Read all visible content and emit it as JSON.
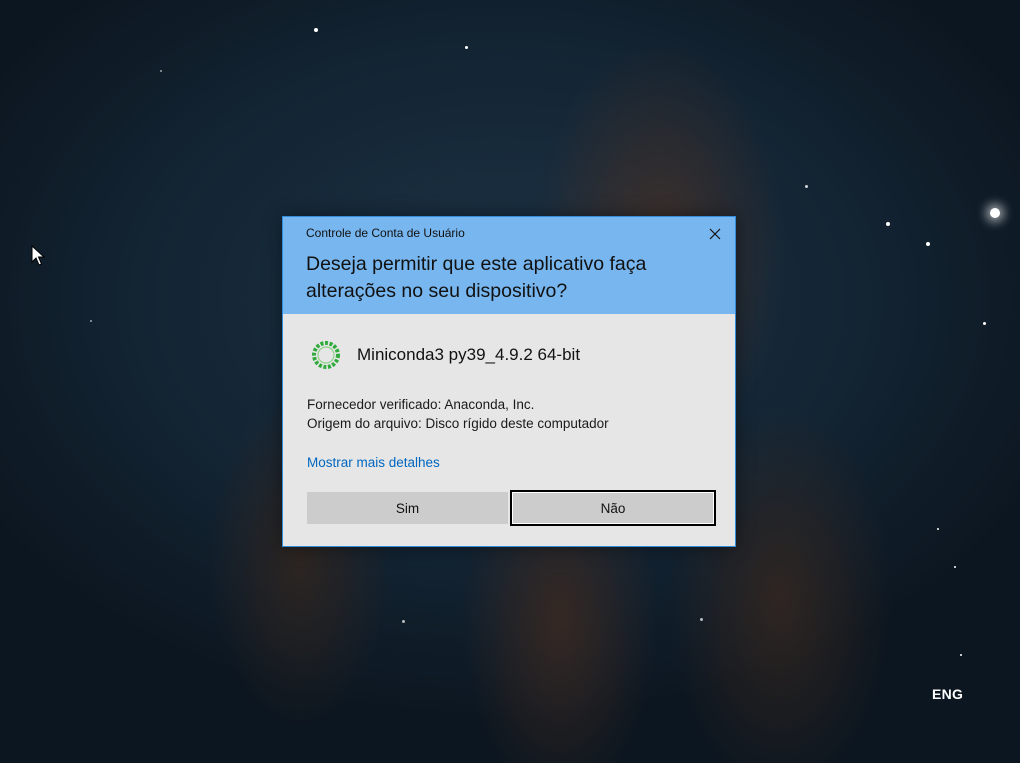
{
  "desktop": {
    "language_indicator": "ENG"
  },
  "uac_dialog": {
    "title": "Controle de Conta de Usuário",
    "question": "Deseja permitir que este aplicativo faça alterações no seu dispositivo?",
    "app_name": "Miniconda3 py39_4.9.2 64-bit",
    "app_icon": "anaconda-ring-icon",
    "publisher_line": "Fornecedor verificado: Anaconda, Inc.",
    "origin_line": "Origem do arquivo: Disco rígido deste computador",
    "details_link": "Mostrar mais detalhes",
    "yes_button": "Sim",
    "no_button": "Não",
    "close_icon": "close-icon"
  },
  "colors": {
    "header_bg": "#77b6ee",
    "body_bg": "#e6e6e6",
    "link": "#0067c0",
    "button_bg": "#cccccc",
    "border_accent": "#2f8ddb"
  }
}
